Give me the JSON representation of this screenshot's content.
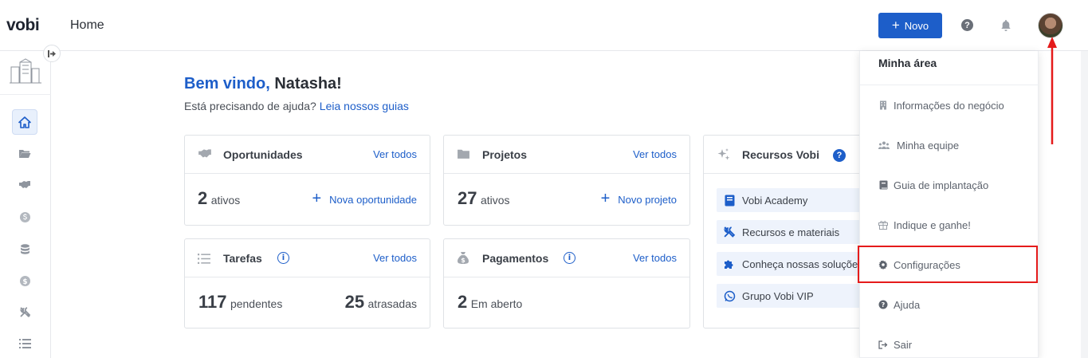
{
  "header": {
    "logo": "vobi",
    "title": "Home",
    "new_button": "Novo",
    "help_glyph": "?"
  },
  "sidebar": {
    "items": [
      {
        "icon": "home-icon",
        "active": true
      },
      {
        "icon": "folder-icon",
        "active": false
      },
      {
        "icon": "handshake-icon",
        "active": false
      },
      {
        "icon": "dollar-circle-icon",
        "active": false
      },
      {
        "icon": "coins-icon",
        "active": false
      },
      {
        "icon": "dollar-coin-icon",
        "active": false
      },
      {
        "icon": "tools-icon",
        "active": false
      },
      {
        "icon": "list-icon",
        "active": false
      }
    ]
  },
  "welcome": {
    "greeting": "Bem vindo,",
    "name": "Natasha!",
    "help_text": "Está precisando de ajuda?",
    "help_link": "Leia nossos guias"
  },
  "cards": {
    "oportunidades": {
      "title": "Oportunidades",
      "see_all": "Ver todos",
      "count": "2",
      "count_label": "ativos",
      "action": "Nova oportunidade"
    },
    "projetos": {
      "title": "Projetos",
      "see_all": "Ver todos",
      "count": "27",
      "count_label": "ativos",
      "action": "Novo projeto"
    },
    "tarefas": {
      "title": "Tarefas",
      "see_all": "Ver todos",
      "pending": "117",
      "pending_label": "pendentes",
      "late": "25",
      "late_label": "atrasadas"
    },
    "pagamentos": {
      "title": "Pagamentos",
      "see_all": "Ver todos",
      "count": "2",
      "count_label": "Em aberto"
    },
    "recursos": {
      "title": "Recursos Vobi",
      "items": [
        "Vobi Academy",
        "Recursos e materiais",
        "Conheça nossas soluções",
        "Grupo Vobi VIP"
      ]
    }
  },
  "dropdown": {
    "title": "Minha área",
    "items": [
      {
        "label": "Informações do negócio",
        "icon": "building-icon"
      },
      {
        "label": "Minha equipe",
        "icon": "team-icon"
      },
      {
        "label": "Guia de implantação",
        "icon": "book-icon"
      },
      {
        "label": "Indique e ganhe!",
        "icon": "gift-icon"
      },
      {
        "label": "Configurações",
        "icon": "gear-icon",
        "highlighted": true
      },
      {
        "label": "Ajuda",
        "icon": "help-icon"
      },
      {
        "label": "Sair",
        "icon": "logout-icon"
      }
    ]
  },
  "colors": {
    "primary": "#1d5ec9",
    "highlight": "#e51b1b",
    "text": "#3a3f47"
  }
}
